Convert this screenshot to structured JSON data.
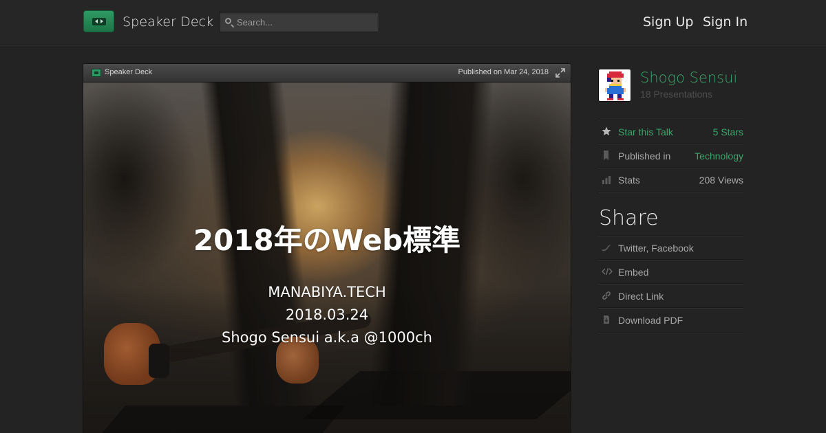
{
  "header": {
    "brand": "Speaker Deck",
    "search_placeholder": "Search...",
    "sign_up": "Sign Up",
    "sign_in": "Sign In"
  },
  "player": {
    "bar_title": "Speaker Deck",
    "published": "Published on Mar 24, 2018",
    "slide": {
      "title": "2018年のWeb標準",
      "lines": [
        "MANABIYA.TECH",
        "2018.03.24",
        "Shogo Sensui a.k.a @1000ch"
      ]
    }
  },
  "sidebar": {
    "author": {
      "name": "Shogo Sensui",
      "presentations": "18 Presentations"
    },
    "stats": [
      {
        "icon": "star-icon",
        "label": "Star this Talk",
        "value": "5 Stars"
      },
      {
        "icon": "bookmark-icon",
        "label": "Published in",
        "value": "Technology"
      },
      {
        "icon": "bar-chart-icon",
        "label": "Stats",
        "value": "208 Views"
      }
    ],
    "share": {
      "title": "Share",
      "items": [
        {
          "icon": "bird-icon",
          "label": "Twitter, Facebook"
        },
        {
          "icon": "code-icon",
          "label": "Embed"
        },
        {
          "icon": "link-icon",
          "label": "Direct Link"
        },
        {
          "icon": "download-icon",
          "label": "Download PDF"
        }
      ]
    }
  },
  "colors": {
    "accent": "#3aa56b",
    "background": "#232323"
  }
}
